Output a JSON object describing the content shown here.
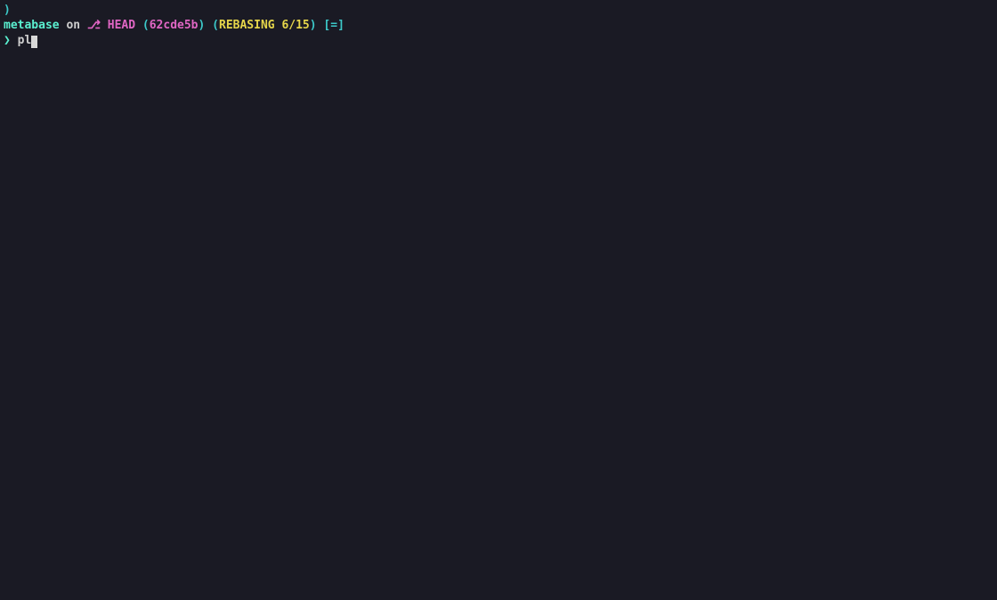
{
  "prompt": {
    "line0_symbol": ")",
    "dir": "metabase",
    "on": " on ",
    "branch_icon": "⎇",
    "branch": " HEAD ",
    "open_paren1": "(",
    "commit": "62cde5b",
    "close_paren1": ")",
    "space1": " ",
    "open_paren2": "(",
    "rebasing": "REBASING 6/15",
    "close_paren2": ")",
    "space2": " ",
    "open_bracket": "[",
    "eq": "=",
    "close_bracket": "]"
  },
  "command": {
    "arrow": "❯",
    "space": " ",
    "typed": "pl"
  }
}
